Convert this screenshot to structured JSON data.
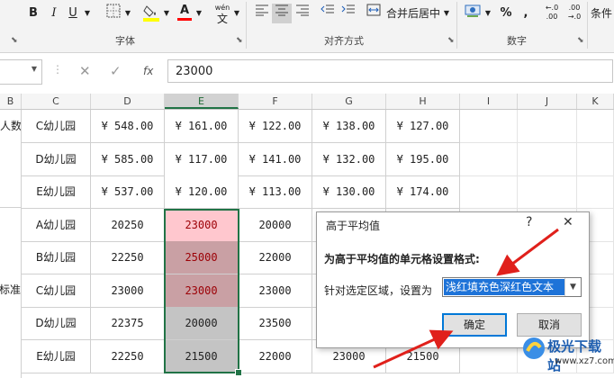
{
  "ribbon": {
    "font_buttons": [
      "B",
      "I",
      "U"
    ],
    "wen_label": "wén",
    "wen_char": "文",
    "fill_glyph": "A",
    "merge_label": "合并后居中",
    "currency_glyph": "%",
    "comma_glyph": ",",
    "dec_inc": "←.0\n.00",
    "dec_dec": ".00\n→.0",
    "cond_label": "条件",
    "groups": {
      "font": "字体",
      "align": "对齐方式",
      "number": "数字"
    },
    "colors": {
      "fill_underline": "#ffff00",
      "font_underline": "#ff0000"
    }
  },
  "formula_bar": {
    "fx": "fx",
    "value": "23000"
  },
  "columns": [
    "B",
    "C",
    "D",
    "E",
    "F",
    "G",
    "H",
    "I",
    "J",
    "K"
  ],
  "selected_column": "E",
  "col_b_text": {
    "top": "人数",
    "middle": "费标准"
  },
  "rows": [
    {
      "c": "C幼儿园",
      "d": "¥ 548.00",
      "e": "¥ 161.00",
      "f": "¥ 122.00",
      "g": "¥ 138.00",
      "h": "¥ 127.00"
    },
    {
      "c": "D幼儿园",
      "d": "¥ 585.00",
      "e": "¥ 117.00",
      "f": "¥ 141.00",
      "g": "¥ 132.00",
      "h": "¥ 195.00"
    },
    {
      "c": "E幼儿园",
      "d": "¥ 537.00",
      "e": "¥ 120.00",
      "f": "¥ 113.00",
      "g": "¥ 130.00",
      "h": "¥ 174.00"
    },
    {
      "c": "A幼儿园",
      "d": "20250",
      "e": "23000",
      "f": "20000",
      "g": "",
      "h": ""
    },
    {
      "c": "B幼儿园",
      "d": "22250",
      "e": "25000",
      "f": "22000",
      "g": "",
      "h": ""
    },
    {
      "c": "C幼儿园",
      "d": "23000",
      "e": "23000",
      "f": "23000",
      "g": "",
      "h": ""
    },
    {
      "c": "D幼儿园",
      "d": "22375",
      "e": "20000",
      "f": "23500",
      "g": "",
      "h": ""
    },
    {
      "c": "E幼儿园",
      "d": "22250",
      "e": "21500",
      "f": "22000",
      "g": "23000",
      "h": "21500"
    }
  ],
  "e_cell_colors": [
    "#ffffff",
    "#ffffff",
    "#ffffff",
    "#ffc7ce",
    "#c9a0a4",
    "#c9a0a4",
    "#c4c4c4",
    "#c4c4c4"
  ],
  "e_text_colors": [
    "#222222",
    "#222222",
    "#222222",
    "#9c0006",
    "#9c0006",
    "#9c0006",
    "#222222",
    "#222222"
  ],
  "dialog": {
    "title": "高于平均值",
    "help": "?",
    "close": "✕",
    "heading": "为高于平均值的单元格设置格式:",
    "label": "针对选定区域，设置为",
    "selected_format": "浅红填充色深红色文本",
    "ok": "确定",
    "cancel": "取消"
  },
  "watermark": {
    "brand": "极光下载站",
    "url": "www.xz7.com"
  }
}
